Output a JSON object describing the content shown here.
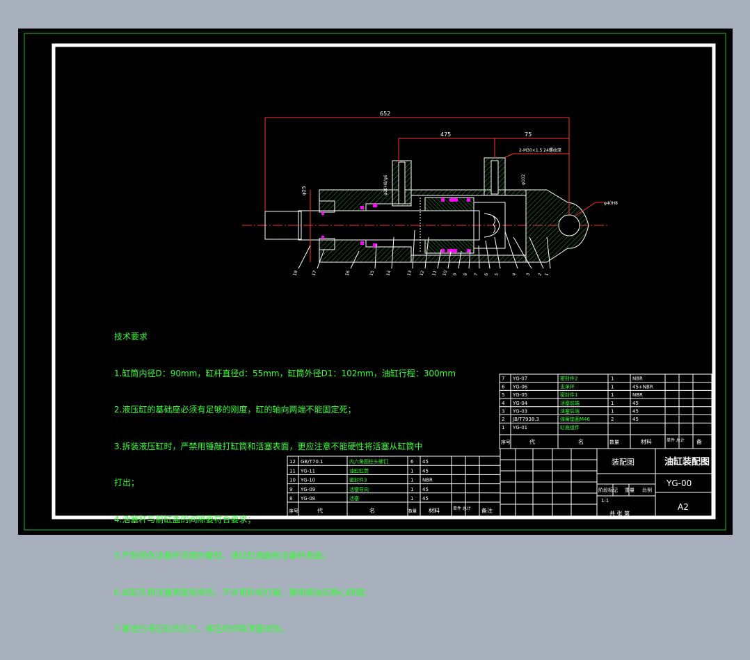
{
  "drawing": {
    "dimensions": {
      "overall_length": "652",
      "length_475": "475",
      "length_75": "75",
      "port_spec": "2-M30×1.5 24螺纹深",
      "dia_25": "φ25",
      "port_dia": "φ30H8/g6",
      "dia_102": "φ102",
      "pin_dia": "φ40H8"
    },
    "balloons": [
      "18",
      "17",
      "16",
      "15",
      "14",
      "13",
      "12",
      "11",
      "10",
      "9",
      "8",
      "7",
      "6",
      "5",
      "4",
      "3",
      "2",
      "1"
    ]
  },
  "notes": {
    "heading": "技术要求",
    "lines": [
      "1.缸筒内径D：90mm，缸杆直径d：55mm，缸筒外径D1：102mm，油缸行程：300mm",
      "2.液压缸的基础座必须有足够的刚度，缸的轴向两端不能固定死；",
      "3.拆装液压缸时，严禁用锤敲打缸筒和活塞表面，更应注意不能硬性将活塞从缸筒中",
      "打出；",
      "4.活塞杆与前缸盖的间隙要符合要求；",
      "5.严防损伤活塞杆顶端的螺纹，液压缸端面和活塞杆表面；",
      "6.如缸孔和活塞表面有损伤，不许用砂纸打磨，要用细油石精心研磨；",
      "7.要进行液压缸的压力、保压时间和泄露试验。"
    ]
  },
  "bom_right": {
    "rows": [
      {
        "no": "7",
        "code": "YG-07",
        "name": "密封件2",
        "qty": "1",
        "mat": "NBR"
      },
      {
        "no": "6",
        "code": "YG-06",
        "name": "支承环",
        "qty": "1",
        "mat": "45+NBR"
      },
      {
        "no": "5",
        "code": "YG-05",
        "name": "密封件1",
        "qty": "1",
        "mat": "NBR"
      },
      {
        "no": "4",
        "code": "YG-04",
        "name": "活塞前端",
        "qty": "1",
        "mat": "45"
      },
      {
        "no": "3",
        "code": "YG-03",
        "name": "活塞后端",
        "qty": "1",
        "mat": "45"
      },
      {
        "no": "2",
        "code": "JB/T7938.3",
        "name": "弹簧垫圈M46",
        "qty": "2",
        "mat": "45"
      },
      {
        "no": "1",
        "code": "YG-01",
        "name": "缸底组件",
        "qty": "",
        "mat": ""
      }
    ],
    "header": {
      "no": "序号",
      "code": "代",
      "name": "名",
      "qty": "数量",
      "mat": "材料",
      "wt": "单件 总计",
      "rem": "备"
    }
  },
  "bom_left": {
    "rows": [
      {
        "no": "12",
        "code": "GB/T70.1",
        "name": "内六角圆柱头螺钉",
        "qty": "6",
        "mat": "45"
      },
      {
        "no": "11",
        "code": "YG-11",
        "name": "油缸缸筒",
        "qty": "1",
        "mat": "45"
      },
      {
        "no": "10",
        "code": "YG-10",
        "name": "密封件3",
        "qty": "1",
        "mat": "NBR"
      },
      {
        "no": "9",
        "code": "YG-09",
        "name": "活塞导向",
        "qty": "1",
        "mat": "45"
      },
      {
        "no": "8",
        "code": "YG-08",
        "name": "活塞",
        "qty": "1",
        "mat": "45"
      }
    ],
    "header": {
      "no": "序号",
      "code": "代",
      "name": "名",
      "qty": "数量",
      "mat": "材料",
      "wt": "单件 总计",
      "rem": "备注"
    }
  },
  "title_block": {
    "drawing_type": "装配图",
    "title": "油缸装配图",
    "drawing_no": "YG-00",
    "sheet_size": "A2",
    "stage": "阶段标记",
    "weight": "重量",
    "scale": "比例",
    "scale_value": "1:1",
    "sheet_count": "共 张 第"
  },
  "colors": {
    "background": "#000000",
    "lines": "#ffffff",
    "text": "#33ff33",
    "hatch": "#2f9a2f",
    "seals": "#ff00ff",
    "dimension": "#ff3333",
    "window": "#a7b0bc"
  }
}
